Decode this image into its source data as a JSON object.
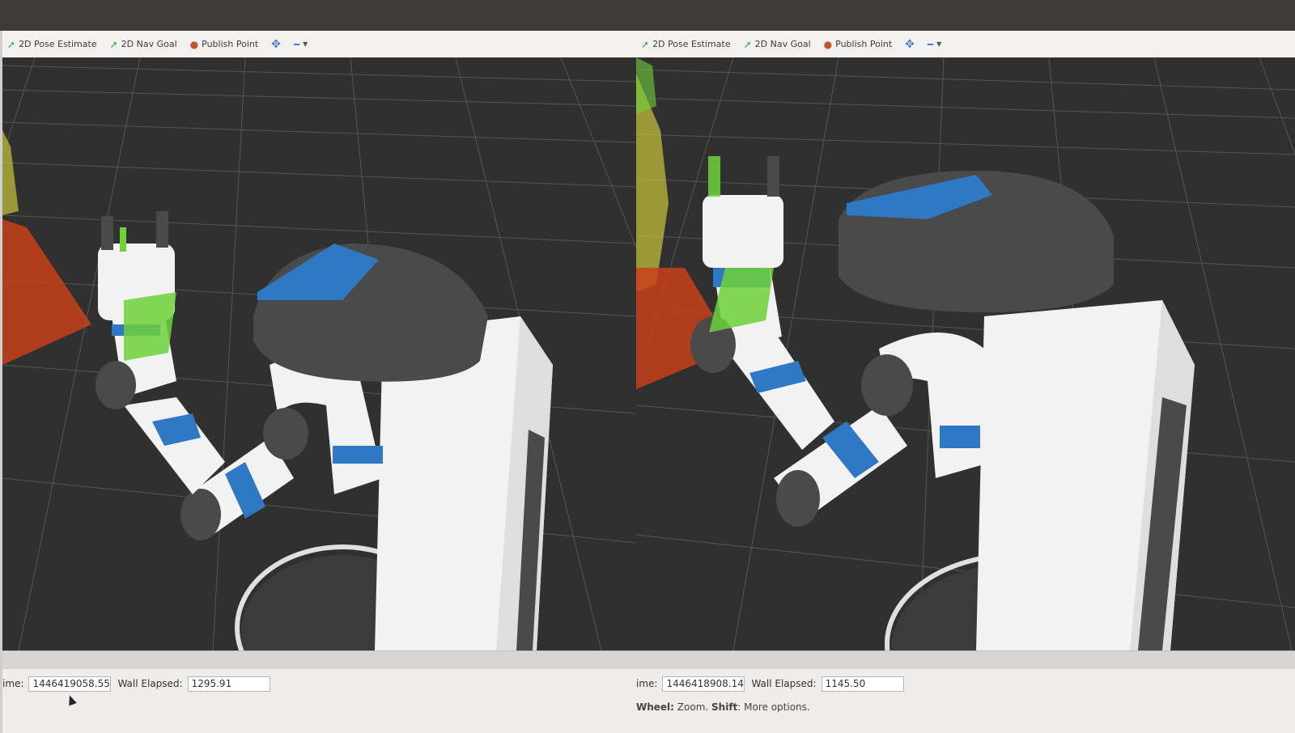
{
  "toolbar": {
    "pose_estimate": "2D Pose Estimate",
    "nav_goal": "2D Nav Goal",
    "publish_point": "Publish Point",
    "icons": {
      "pose_estimate": "pose-estimate-arrow-icon",
      "nav_goal": "nav-goal-arrow-icon",
      "publish_point": "map-pin-icon",
      "add": "plus-move-icon",
      "remove": "minus-icon"
    }
  },
  "left_panel": {
    "time_label": "ime:",
    "time_value": "1446419058.55",
    "wall_elapsed_label": "Wall Elapsed:",
    "wall_elapsed_value": "1295.91"
  },
  "right_panel": {
    "time_label": "ime:",
    "time_value": "1446418908.14",
    "wall_elapsed_label": "Wall Elapsed:",
    "wall_elapsed_value": "1145.50",
    "hint_wheel": "Wheel:",
    "hint_zoom": " Zoom. ",
    "hint_shift": "Shift",
    "hint_more": ": More options."
  },
  "colors": {
    "grid_bg": "#303030",
    "robot_white": "#f2f2f2",
    "robot_gray": "#4a4a4b",
    "robot_blue": "#2f78c4",
    "points_green": "#6fd13a",
    "points_red": "#c8401c",
    "points_yellow": "#c9c43a"
  }
}
